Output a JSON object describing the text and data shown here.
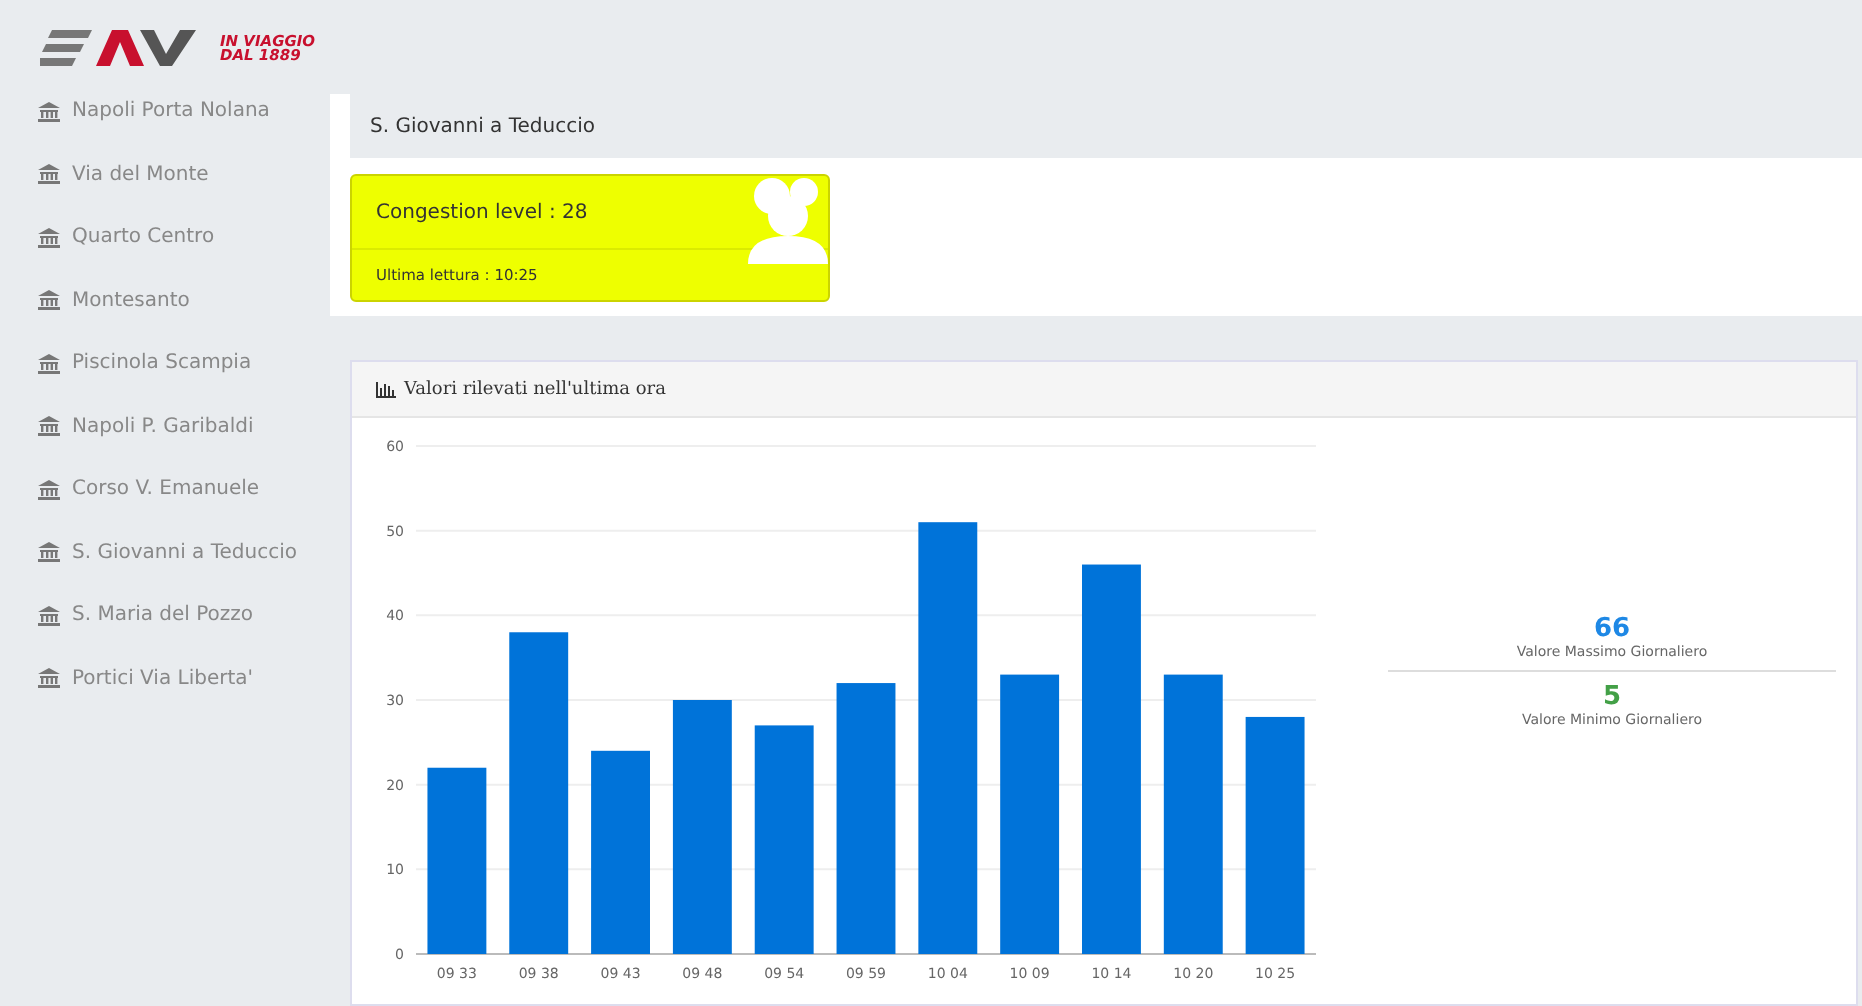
{
  "logo": {
    "tagline": [
      "IN VIAGGIO",
      "DAL 1889"
    ]
  },
  "sidebar": {
    "items": [
      {
        "label": "Napoli Porta Nolana",
        "selected": false
      },
      {
        "label": "Via del Monte",
        "selected": false
      },
      {
        "label": "Quarto Centro",
        "selected": false
      },
      {
        "label": "Montesanto",
        "selected": false
      },
      {
        "label": "Piscinola Scampia",
        "selected": false
      },
      {
        "label": "Napoli P. Garibaldi",
        "selected": false
      },
      {
        "label": "Corso V. Emanuele",
        "selected": false
      },
      {
        "label": "S. Giovanni a Teduccio",
        "selected": false
      },
      {
        "label": "S. Maria del Pozzo",
        "selected": false
      },
      {
        "label": "Portici Via Liberta'",
        "selected": false
      }
    ]
  },
  "station": {
    "title": "S. Giovanni a Teduccio"
  },
  "congestion_card": {
    "title": "Congestion level : 28",
    "footer": "Ultima lettura : 10:25",
    "color": "#eeff00"
  },
  "chart_panel": {
    "title": "Valori rilevati nell'ultima ora",
    "chart_data": {
      "type": "bar",
      "categories": [
        "09 33",
        "09 38",
        "09 43",
        "09 48",
        "09 54",
        "09 59",
        "10 04",
        "10 09",
        "10 14",
        "10 20",
        "10 25"
      ],
      "series": [
        {
          "color": "#0073d9",
          "values": [
            22,
            38,
            24,
            30,
            27,
            32,
            51,
            33,
            46,
            33,
            28
          ]
        }
      ],
      "grid": true,
      "ylim": [
        0,
        60
      ],
      "yticks": [
        0,
        10,
        20,
        30,
        40,
        50,
        60
      ]
    },
    "stats": [
      {
        "value": "66",
        "label": "Valore Massimo Giornaliero",
        "color": "#1e88e5"
      },
      {
        "value": "5",
        "label": "Valore Minimo Giornaliero",
        "color": "#43a047"
      }
    ]
  }
}
